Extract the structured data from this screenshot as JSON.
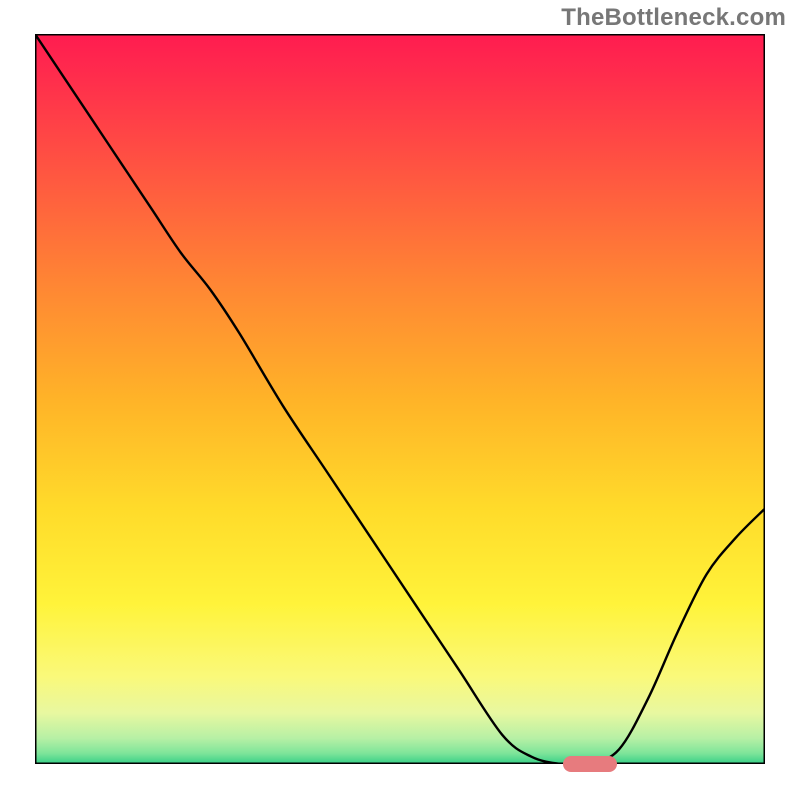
{
  "watermark": "TheBottleneck.com",
  "chart_data": {
    "type": "line",
    "title": "",
    "xlabel": "",
    "ylabel": "",
    "xlim": [
      0,
      100
    ],
    "ylim": [
      0,
      100
    ],
    "gradient_stops": [
      {
        "offset": 0.0,
        "color": "#ff1c50"
      },
      {
        "offset": 0.05,
        "color": "#ff2a4d"
      },
      {
        "offset": 0.2,
        "color": "#ff5940"
      },
      {
        "offset": 0.35,
        "color": "#ff8833"
      },
      {
        "offset": 0.5,
        "color": "#ffb328"
      },
      {
        "offset": 0.65,
        "color": "#ffdb2a"
      },
      {
        "offset": 0.78,
        "color": "#fff33a"
      },
      {
        "offset": 0.88,
        "color": "#faf97a"
      },
      {
        "offset": 0.93,
        "color": "#e8f8a0"
      },
      {
        "offset": 0.965,
        "color": "#b6f0a5"
      },
      {
        "offset": 0.985,
        "color": "#7fe59a"
      },
      {
        "offset": 1.0,
        "color": "#36cf87"
      }
    ],
    "series": [
      {
        "name": "curve",
        "x": [
          0,
          4,
          8,
          12,
          16,
          20,
          24,
          28,
          34,
          40,
          46,
          52,
          58,
          64,
          68,
          72,
          76,
          80,
          84,
          88,
          92,
          96,
          100
        ],
        "y": [
          100,
          94,
          88,
          82,
          76,
          70,
          65,
          59,
          49,
          40,
          31,
          22,
          13,
          4,
          1,
          0,
          0,
          2,
          9,
          18,
          26,
          31,
          35
        ]
      }
    ],
    "marker": {
      "x": 76,
      "y": 0,
      "color": "#e77b7e"
    }
  }
}
